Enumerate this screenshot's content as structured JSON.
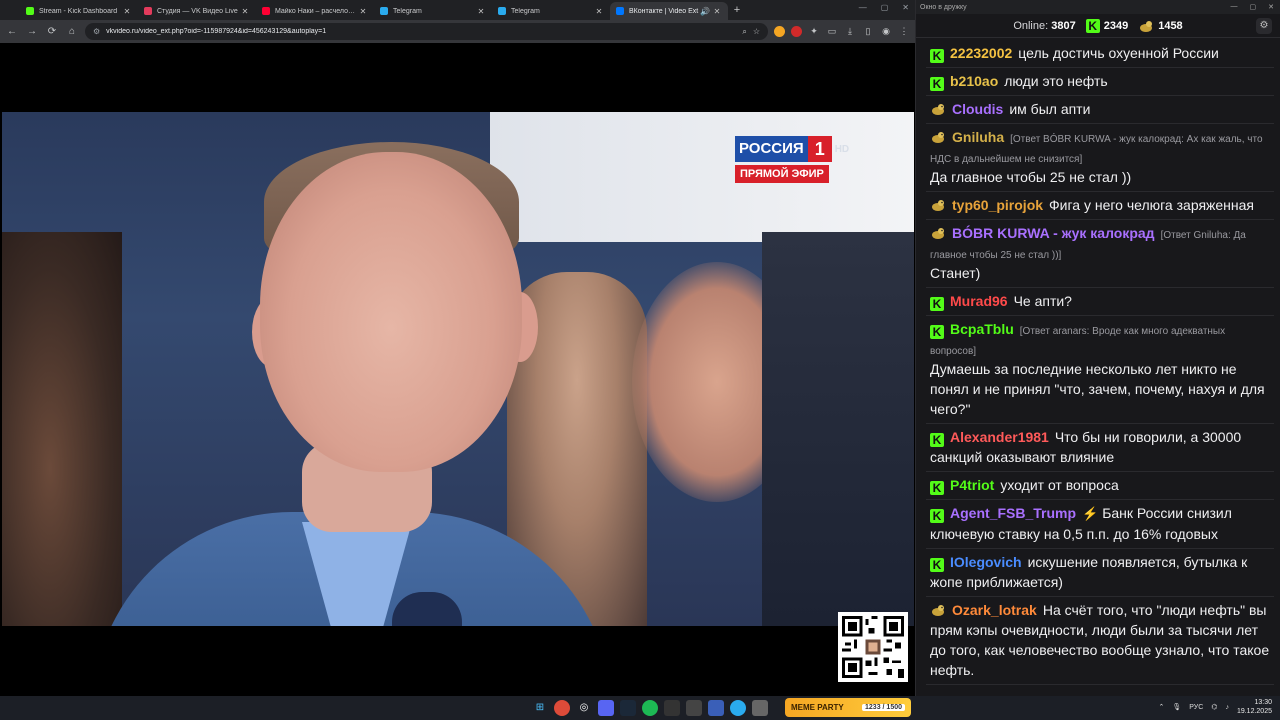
{
  "browser": {
    "tabs": [
      {
        "label": "Stream - Kick Dashboard",
        "color": "#53fc18",
        "active": false
      },
      {
        "label": "Студия — VK Видео Live",
        "color": "#e43b5c",
        "active": false
      },
      {
        "label": "Майко Наки – расчеловечив...",
        "color": "#ff0033",
        "active": false
      },
      {
        "label": "Telegram",
        "color": "#2aabee",
        "active": false
      },
      {
        "label": "Telegram",
        "color": "#2aabee",
        "active": false
      },
      {
        "label": "ВКонтакте | Video Ext",
        "color": "#0077ff",
        "active": true
      }
    ],
    "url": "vkvideo.ru/video_ext.php?oid=-115987924&id=456243129&autoplay=1"
  },
  "video": {
    "channel_name": "РОССИЯ",
    "channel_number": "1",
    "channel_hd": "HD",
    "live_label": "ПРЯМОЙ ЭФИР"
  },
  "chat": {
    "window_title": "Окно в дружку",
    "online_label": "Online:",
    "online_count": "3807",
    "kick_count": "2349",
    "bobr_count": "1458",
    "messages": [
      {
        "badge": "kick",
        "user": "22232002",
        "color": "#f5c242",
        "reply": "",
        "text": "цель достичь охуенной России"
      },
      {
        "badge": "kick",
        "user": "b210ao",
        "color": "#e8c24a",
        "reply": "",
        "text": "люди это нефть"
      },
      {
        "badge": "bobr",
        "user": "Cloudis",
        "color": "#a970ff",
        "reply": "",
        "text": "им был апти"
      },
      {
        "badge": "bobr",
        "user": "Gniluha",
        "color": "#d4b04a",
        "reply": "[Ответ BÓBR KURWA - жук калокрад: Ах как жаль, что НДС в дальнейшем не снизится]",
        "text": "Да главное чтобы 25 не стал ))"
      },
      {
        "badge": "bobr",
        "user": "typ60_pirojok",
        "color": "#e8a33a",
        "reply": "",
        "text": "Фига у него челюга заряженная"
      },
      {
        "badge": "bobr",
        "user": "BÓBR KURWA - жук калокрад",
        "color": "#a970ff",
        "reply": "[Ответ Gniluha: Да главное чтобы 25 не стал ))]",
        "text": "Станет)"
      },
      {
        "badge": "kick",
        "user": "Murad96",
        "color": "#ff4a4a",
        "reply": "",
        "text": "Че апти?"
      },
      {
        "badge": "kick",
        "user": "BcpaTblu",
        "color": "#53fc18",
        "reply": "[Ответ aranars: Вроде как много адекватных вопросов]",
        "text": "Думаешь за последние несколько лет никто не понял и не принял \"что, зачем, почему, нахуя и для чего?\""
      },
      {
        "badge": "kick",
        "user": "Alexander1981",
        "color": "#ff5a5a",
        "reply": "",
        "text": "Что бы ни говорили, а 30000 санкций оказывают влияние"
      },
      {
        "badge": "kick",
        "user": "P4triot",
        "color": "#53fc18",
        "reply": "",
        "text": "уходит от вопроса"
      },
      {
        "badge": "kick",
        "user": "Agent_FSB_Trump",
        "color": "#a970ff",
        "reply": "",
        "text": "Банк России снизил ключевую ставку на 0,5 п.п. до 16% годовых",
        "bolt": true
      },
      {
        "badge": "kick",
        "user": "IOlegovich",
        "color": "#4a8cff",
        "reply": "",
        "text": "искушение появляется, бутылка к жопе приближается)"
      },
      {
        "badge": "bobr",
        "user": "Ozark_lotrak",
        "color": "#ff8a3a",
        "reply": "",
        "text": "На счёт того, что \"люди нефть\" вы прям кэпы очевидности, люди были за тысячи лет до того, как человечество вообще узнало, что такое нефть."
      }
    ]
  },
  "taskbar": {
    "meme_label": "MEME PARTY",
    "meme_timer": "1233 / 1500",
    "lang": "РУС",
    "time": "13:30",
    "date": "19.12.2025"
  }
}
